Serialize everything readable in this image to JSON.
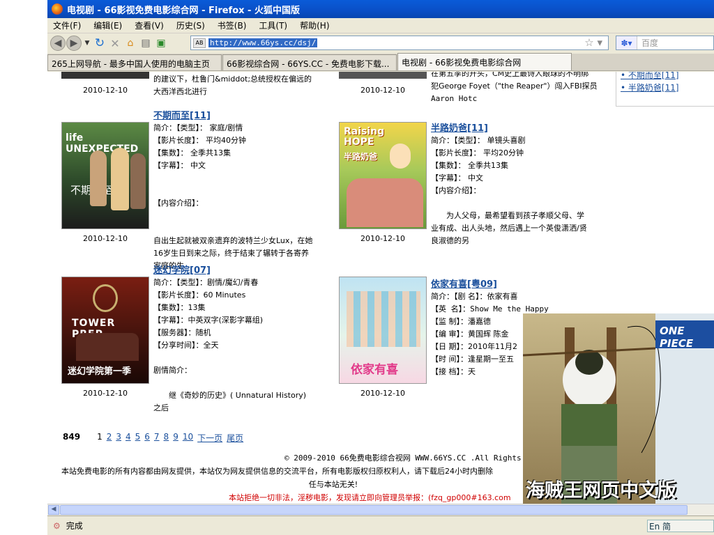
{
  "window": {
    "title": "电视剧 - 66影视免费电影综合网 - Firefox - 火狐中国版"
  },
  "menu": [
    "文件(F)",
    "编辑(E)",
    "查看(V)",
    "历史(S)",
    "书签(B)",
    "工具(T)",
    "帮助(H)"
  ],
  "nav": {
    "url": "http://www.66ys.cc/dsj/",
    "search_placeholder": "百度"
  },
  "tabs": [
    {
      "label": "265上网导航 - 最多中国人使用的电脑主页"
    },
    {
      "label": "66影视综合网 - 66YS.CC - 免费电影下载..."
    },
    {
      "label": "电视剧 - 66影视免费电影综合网"
    }
  ],
  "top_fragment": {
    "left_text": [
      "的建议下，杜鲁门&middot;总统授权在偏远的",
      "大西洋西北进行"
    ],
    "left_date": "2010-12-10",
    "right_text": [
      "在第五季的开头，CM史上最诗人眼球的不明绑",
      "犯George Foyet（\"the Reaper\"）闯入FBI探员",
      "Aaron Hotc"
    ],
    "right_date": "2010-12-10"
  },
  "sidebar_links": [
    "不期而至[11]",
    "半路奶爸[11]"
  ],
  "entries": [
    {
      "title": "不期而至[11]",
      "lines": [
        "简介：【类型】： 家庭/剧情",
        "【影片长度】： 平均40分钟",
        "【集数】： 全季共13集",
        "【字幕】： 中文",
        "",
        "",
        "【内容介绍】：",
        "",
        "",
        "自出生起就被双亲遗弃的波特兰少女Lux，在她",
        "16岁生日到来之际，终于结束了辗转于各寄养",
        "家庭的生"
      ],
      "date": "2010-12-10",
      "poster_text": "life UNEXPECTED",
      "poster_sub": "不期而至"
    },
    {
      "title": "半路奶爸[11]",
      "lines": [
        "简介：【类型】： 单镜头喜剧",
        "【影片长度】： 平均20分钟",
        "【集数】： 全季共13集",
        "【字幕】： 中文",
        "【内容介绍】：",
        "",
        "　　为人父母，最希望看到孩子孝顺父母、学",
        "业有成、出人头地，然后遇上一个英俊潇洒/贤",
        "良淑德的另"
      ],
      "date": "2010-12-10",
      "poster_text": "Raising HOPE",
      "poster_sub": "半路奶爸"
    },
    {
      "title": "迷幻学院[07]",
      "lines": [
        "简介：【类型】：剧情/魔幻/青春",
        "【影片长度】：60 Minutes",
        "【集数】：13集",
        "【字幕】：中英双字(深影字幕组)",
        "【服务器】：随机",
        "【分享时间】：全天",
        "",
        "剧情简介：",
        "",
        "　　继《奇妙的历史》( Unnatural History)",
        "之后"
      ],
      "date": "2010-12-10",
      "poster_text": "TOWER PREP",
      "poster_sub": "迷幻学院第一季"
    },
    {
      "title": "依家有喜[粤09]",
      "lines": [
        "简介：【剧 名】：依家有喜",
        "【英 名】：Show Me the Happy",
        "【监 制】：潘嘉德",
        "【编 审】：黄国辉 陈金",
        "【日 期】：2010年11月2",
        "【时 间】：逢星期一至五",
        "【接 档】：天"
      ],
      "date": "2010-12-10",
      "poster_text": "依家有喜"
    }
  ],
  "pager": {
    "total": "849",
    "current": "1",
    "pages": [
      "2",
      "3",
      "4",
      "5",
      "6",
      "7",
      "8",
      "9",
      "10"
    ],
    "next": "下一页",
    "last": "尾页"
  },
  "footer": {
    "line1": "© 2009-2010 66免费电影综合视网 WWW.66YS.CC .All Rights Reser",
    "line2": "本站免费电影的所有内容都由网友提供，本站仅为网友提供信息的交流平台，所有电影版权归原权利人，请下载后24小时内删除",
    "line3": "任与本站无关!",
    "line4": "本站拒绝一切非法，淫秽电影，发现请立即向管理员举报：(fzq_gp000#163.com"
  },
  "overlay": {
    "caption": "海贼王网页中文版",
    "logo": "ONE PIECE"
  },
  "status": {
    "text": "完成",
    "ime": "En 简"
  }
}
